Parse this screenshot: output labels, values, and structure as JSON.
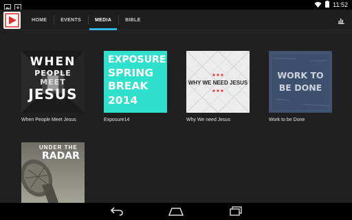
{
  "statusbar": {
    "time": "11:52"
  },
  "nav": {
    "tabs": [
      {
        "label": "HOME"
      },
      {
        "label": "EVENTS"
      },
      {
        "label": "MEDIA"
      },
      {
        "label": "BIBLE"
      }
    ],
    "active_tab": "MEDIA",
    "accent_color": "#33b5e5"
  },
  "media": {
    "items": [
      {
        "title": "When People Meet Jesus",
        "art": {
          "lines": [
            "WHEN",
            "PEOPLE",
            "MEET",
            "JESUS"
          ]
        }
      },
      {
        "title": "Exposure14",
        "art": {
          "lines": [
            "EXPOSURE",
            "SPRING",
            "BREAK",
            "2014"
          ]
        }
      },
      {
        "title": "Why We need Jesus",
        "art": {
          "lines": [
            "WHY WE NEED JESUS"
          ]
        }
      },
      {
        "title": "Work to be Done",
        "art": {
          "lines": [
            "WORK TO",
            "BE DONE"
          ]
        }
      },
      {
        "title": "",
        "art": {
          "lines": [
            "UNDER THE",
            "RADAR"
          ]
        }
      }
    ]
  }
}
